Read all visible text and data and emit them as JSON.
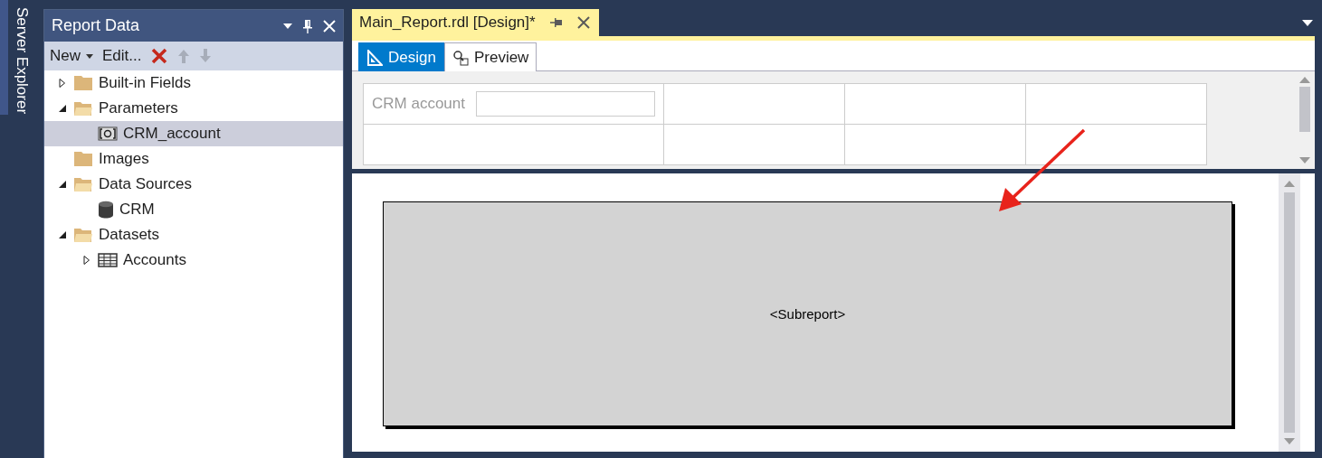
{
  "side_tab": {
    "label": "Server Explorer"
  },
  "report_data": {
    "title": "Report Data",
    "toolbar": [
      {
        "kind": "dropdown",
        "label": "New",
        "disabled": false
      },
      {
        "kind": "text",
        "label": "Edit...",
        "disabled": false
      },
      {
        "kind": "delete",
        "disabled": false
      },
      {
        "kind": "up",
        "disabled": true
      },
      {
        "kind": "down",
        "disabled": true
      }
    ],
    "tree": [
      {
        "label": "Built-in Fields",
        "kind": "folder",
        "expanded": false,
        "selected": false
      },
      {
        "label": "Parameters",
        "kind": "folder",
        "expanded": true,
        "selected": false,
        "children": [
          {
            "label": "CRM_account",
            "kind": "parameter",
            "selected": true
          }
        ]
      },
      {
        "label": "Images",
        "kind": "folder",
        "selected": false
      },
      {
        "label": "Data Sources",
        "kind": "folder",
        "expanded": true,
        "selected": false,
        "children": [
          {
            "label": "CRM",
            "kind": "datasource",
            "selected": false
          }
        ]
      },
      {
        "label": "Datasets",
        "kind": "folder",
        "expanded": true,
        "selected": false,
        "children": [
          {
            "label": "Accounts",
            "kind": "dataset",
            "expanded": false,
            "selected": false
          }
        ]
      }
    ]
  },
  "document": {
    "tab_title": "Main_Report.rdl [Design]*",
    "view_tabs": [
      {
        "label": "Design",
        "kind": "design",
        "selected": true
      },
      {
        "label": "Preview",
        "kind": "preview",
        "selected": false
      }
    ],
    "parameters": [
      {
        "label": "CRM account"
      }
    ],
    "subreport": {
      "label": "<Subreport>"
    }
  }
}
